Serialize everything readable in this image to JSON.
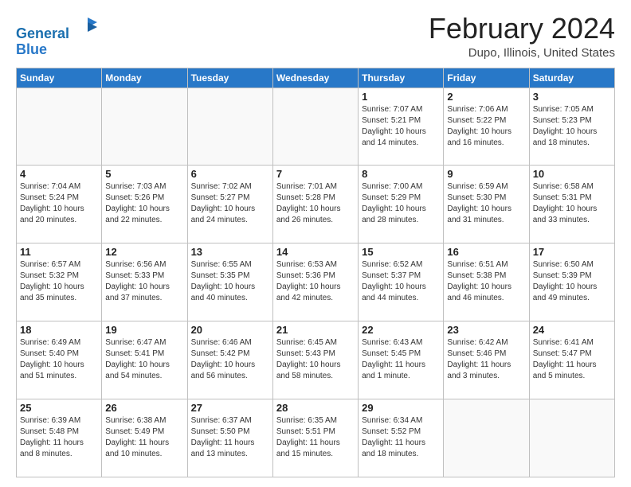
{
  "header": {
    "logo_line1": "General",
    "logo_line2": "Blue",
    "month_year": "February 2024",
    "location": "Dupo, Illinois, United States"
  },
  "days_of_week": [
    "Sunday",
    "Monday",
    "Tuesday",
    "Wednesday",
    "Thursday",
    "Friday",
    "Saturday"
  ],
  "weeks": [
    [
      {
        "day": "",
        "info": ""
      },
      {
        "day": "",
        "info": ""
      },
      {
        "day": "",
        "info": ""
      },
      {
        "day": "",
        "info": ""
      },
      {
        "day": "1",
        "info": "Sunrise: 7:07 AM\nSunset: 5:21 PM\nDaylight: 10 hours\nand 14 minutes."
      },
      {
        "day": "2",
        "info": "Sunrise: 7:06 AM\nSunset: 5:22 PM\nDaylight: 10 hours\nand 16 minutes."
      },
      {
        "day": "3",
        "info": "Sunrise: 7:05 AM\nSunset: 5:23 PM\nDaylight: 10 hours\nand 18 minutes."
      }
    ],
    [
      {
        "day": "4",
        "info": "Sunrise: 7:04 AM\nSunset: 5:24 PM\nDaylight: 10 hours\nand 20 minutes."
      },
      {
        "day": "5",
        "info": "Sunrise: 7:03 AM\nSunset: 5:26 PM\nDaylight: 10 hours\nand 22 minutes."
      },
      {
        "day": "6",
        "info": "Sunrise: 7:02 AM\nSunset: 5:27 PM\nDaylight: 10 hours\nand 24 minutes."
      },
      {
        "day": "7",
        "info": "Sunrise: 7:01 AM\nSunset: 5:28 PM\nDaylight: 10 hours\nand 26 minutes."
      },
      {
        "day": "8",
        "info": "Sunrise: 7:00 AM\nSunset: 5:29 PM\nDaylight: 10 hours\nand 28 minutes."
      },
      {
        "day": "9",
        "info": "Sunrise: 6:59 AM\nSunset: 5:30 PM\nDaylight: 10 hours\nand 31 minutes."
      },
      {
        "day": "10",
        "info": "Sunrise: 6:58 AM\nSunset: 5:31 PM\nDaylight: 10 hours\nand 33 minutes."
      }
    ],
    [
      {
        "day": "11",
        "info": "Sunrise: 6:57 AM\nSunset: 5:32 PM\nDaylight: 10 hours\nand 35 minutes."
      },
      {
        "day": "12",
        "info": "Sunrise: 6:56 AM\nSunset: 5:33 PM\nDaylight: 10 hours\nand 37 minutes."
      },
      {
        "day": "13",
        "info": "Sunrise: 6:55 AM\nSunset: 5:35 PM\nDaylight: 10 hours\nand 40 minutes."
      },
      {
        "day": "14",
        "info": "Sunrise: 6:53 AM\nSunset: 5:36 PM\nDaylight: 10 hours\nand 42 minutes."
      },
      {
        "day": "15",
        "info": "Sunrise: 6:52 AM\nSunset: 5:37 PM\nDaylight: 10 hours\nand 44 minutes."
      },
      {
        "day": "16",
        "info": "Sunrise: 6:51 AM\nSunset: 5:38 PM\nDaylight: 10 hours\nand 46 minutes."
      },
      {
        "day": "17",
        "info": "Sunrise: 6:50 AM\nSunset: 5:39 PM\nDaylight: 10 hours\nand 49 minutes."
      }
    ],
    [
      {
        "day": "18",
        "info": "Sunrise: 6:49 AM\nSunset: 5:40 PM\nDaylight: 10 hours\nand 51 minutes."
      },
      {
        "day": "19",
        "info": "Sunrise: 6:47 AM\nSunset: 5:41 PM\nDaylight: 10 hours\nand 54 minutes."
      },
      {
        "day": "20",
        "info": "Sunrise: 6:46 AM\nSunset: 5:42 PM\nDaylight: 10 hours\nand 56 minutes."
      },
      {
        "day": "21",
        "info": "Sunrise: 6:45 AM\nSunset: 5:43 PM\nDaylight: 10 hours\nand 58 minutes."
      },
      {
        "day": "22",
        "info": "Sunrise: 6:43 AM\nSunset: 5:45 PM\nDaylight: 11 hours\nand 1 minute."
      },
      {
        "day": "23",
        "info": "Sunrise: 6:42 AM\nSunset: 5:46 PM\nDaylight: 11 hours\nand 3 minutes."
      },
      {
        "day": "24",
        "info": "Sunrise: 6:41 AM\nSunset: 5:47 PM\nDaylight: 11 hours\nand 5 minutes."
      }
    ],
    [
      {
        "day": "25",
        "info": "Sunrise: 6:39 AM\nSunset: 5:48 PM\nDaylight: 11 hours\nand 8 minutes."
      },
      {
        "day": "26",
        "info": "Sunrise: 6:38 AM\nSunset: 5:49 PM\nDaylight: 11 hours\nand 10 minutes."
      },
      {
        "day": "27",
        "info": "Sunrise: 6:37 AM\nSunset: 5:50 PM\nDaylight: 11 hours\nand 13 minutes."
      },
      {
        "day": "28",
        "info": "Sunrise: 6:35 AM\nSunset: 5:51 PM\nDaylight: 11 hours\nand 15 minutes."
      },
      {
        "day": "29",
        "info": "Sunrise: 6:34 AM\nSunset: 5:52 PM\nDaylight: 11 hours\nand 18 minutes."
      },
      {
        "day": "",
        "info": ""
      },
      {
        "day": "",
        "info": ""
      }
    ]
  ]
}
